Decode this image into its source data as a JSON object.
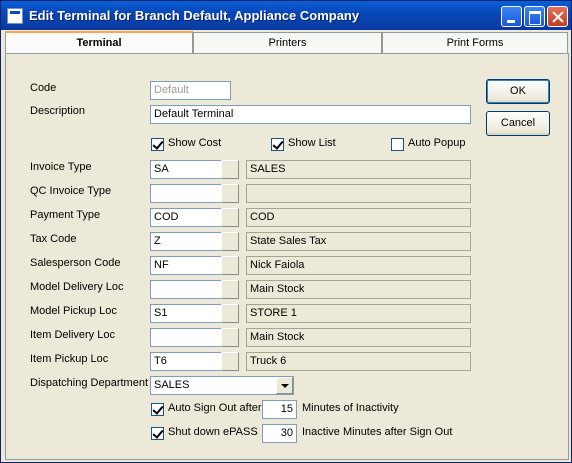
{
  "window": {
    "title": "Edit Terminal  for Branch Default, Appliance Company"
  },
  "tabs": [
    {
      "label": "Terminal"
    },
    {
      "label": "Printers"
    },
    {
      "label": "Print Forms"
    }
  ],
  "form": {
    "code_label": "Code",
    "code_value": "Default",
    "description_label": "Description",
    "description_value": "Default Terminal",
    "show_cost_label": "Show Cost",
    "show_list_label": "Show List",
    "auto_popup_label": "Auto Popup",
    "show_cost_checked": true,
    "show_list_checked": true,
    "auto_popup_checked": false,
    "rows": [
      {
        "label": "Invoice Type",
        "code": "SA",
        "desc": "SALES"
      },
      {
        "label": "QC Invoice Type",
        "code": "",
        "desc": ""
      },
      {
        "label": "Payment Type",
        "code": "COD",
        "desc": "COD"
      },
      {
        "label": "Tax Code",
        "code": "Z",
        "desc": "State Sales Tax"
      },
      {
        "label": "Salesperson Code",
        "code": "NF",
        "desc": "Nick Faiola"
      },
      {
        "label": "Model Delivery Loc",
        "code": "",
        "desc": "Main Stock"
      },
      {
        "label": "Model Pickup Loc",
        "code": "S1",
        "desc": "STORE 1"
      },
      {
        "label": "Item Delivery Loc",
        "code": "",
        "desc": "Main Stock"
      },
      {
        "label": "Item Pickup Loc",
        "code": "T6",
        "desc": "Truck 6"
      }
    ],
    "dispatch_label": "Dispatching Department",
    "dispatch_value": "SALES",
    "auto_signout_label": "Auto Sign Out after",
    "auto_signout_checked": true,
    "auto_signout_value": "15",
    "auto_signout_suffix": "Minutes of Inactivity",
    "shutdown_label": "Shut down ePASS",
    "shutdown_checked": true,
    "shutdown_value": "30",
    "shutdown_suffix": "Inactive Minutes after Sign Out"
  },
  "buttons": {
    "ok": "OK",
    "cancel": "Cancel"
  }
}
